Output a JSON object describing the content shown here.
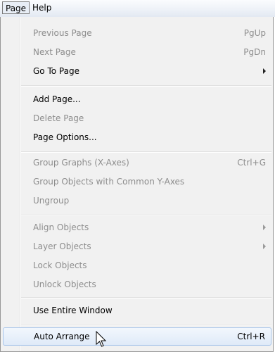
{
  "menubar": {
    "items": [
      {
        "label": "Page",
        "active": true
      },
      {
        "label": "Help",
        "active": false
      }
    ]
  },
  "menu": {
    "items": [
      {
        "label": "Previous Page",
        "shortcut": "PgUp",
        "enabled": false
      },
      {
        "label": "Next Page",
        "shortcut": "PgDn",
        "enabled": false
      },
      {
        "label": "Go To Page",
        "shortcut": "",
        "enabled": true,
        "submenu": true
      },
      {
        "label": "Add Page...",
        "shortcut": "",
        "enabled": true
      },
      {
        "label": "Delete Page",
        "shortcut": "",
        "enabled": false
      },
      {
        "label": "Page Options...",
        "shortcut": "",
        "enabled": true
      },
      {
        "label": "Group Graphs (X-Axes)",
        "shortcut": "Ctrl+G",
        "enabled": false
      },
      {
        "label": "Group Objects with Common Y-Axes",
        "shortcut": "",
        "enabled": false
      },
      {
        "label": "Ungroup",
        "shortcut": "",
        "enabled": false
      },
      {
        "label": "Align Objects",
        "shortcut": "",
        "enabled": false,
        "submenu": true
      },
      {
        "label": "Layer Objects",
        "shortcut": "",
        "enabled": false,
        "submenu": true
      },
      {
        "label": "Lock Objects",
        "shortcut": "",
        "enabled": false
      },
      {
        "label": "Unlock Objects",
        "shortcut": "",
        "enabled": false
      },
      {
        "label": "Use Entire Window",
        "shortcut": "",
        "enabled": true
      },
      {
        "label": "Auto Arrange",
        "shortcut": "Ctrl+R",
        "enabled": true,
        "highlighted": true
      }
    ]
  },
  "colors": {
    "menu_bg": "#f1f1f1",
    "disabled_text": "#8d8d8d",
    "highlight_border": "#a9c6ea"
  },
  "icons": {
    "cursor": "mouse-pointer-icon"
  }
}
